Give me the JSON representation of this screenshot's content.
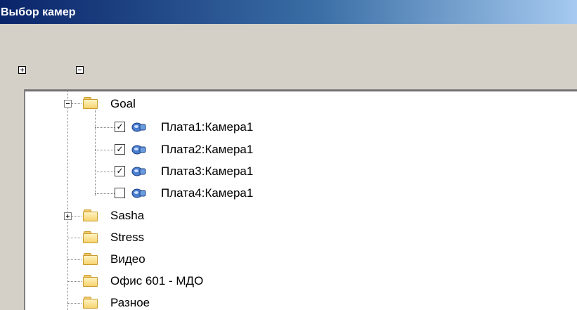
{
  "window": {
    "title": "Выбор камер"
  },
  "toolbar": {
    "expand_all_icon": "plus-square-icon",
    "collapse_all_icon": "minus-square-icon"
  },
  "tree": {
    "nodes": [
      {
        "label": "Goal",
        "type": "folder",
        "expanded": true
      },
      {
        "label": "Плата1:Камера1",
        "type": "camera",
        "checked": true,
        "check_mark": "✓"
      },
      {
        "label": "Плата2:Камера1",
        "type": "camera",
        "checked": true,
        "check_mark": "✓"
      },
      {
        "label": "Плата3:Камера1",
        "type": "camera",
        "checked": true,
        "check_mark": "✓"
      },
      {
        "label": "Плата4:Камера1",
        "type": "camera",
        "checked": false,
        "check_mark": ""
      },
      {
        "label": "Sasha",
        "type": "folder",
        "expanded": false
      },
      {
        "label": "Stress",
        "type": "folder"
      },
      {
        "label": "Видео",
        "type": "folder"
      },
      {
        "label": "Офис 601 - МДО",
        "type": "folder"
      },
      {
        "label": "Разное",
        "type": "folder"
      }
    ]
  },
  "colors": {
    "titlebar_start": "#0a246a",
    "titlebar_end": "#a6caf0",
    "window_bg": "#d4d0c8",
    "folder_yellow": "#f6d36f",
    "camera_blue": "#4a7fd0"
  }
}
